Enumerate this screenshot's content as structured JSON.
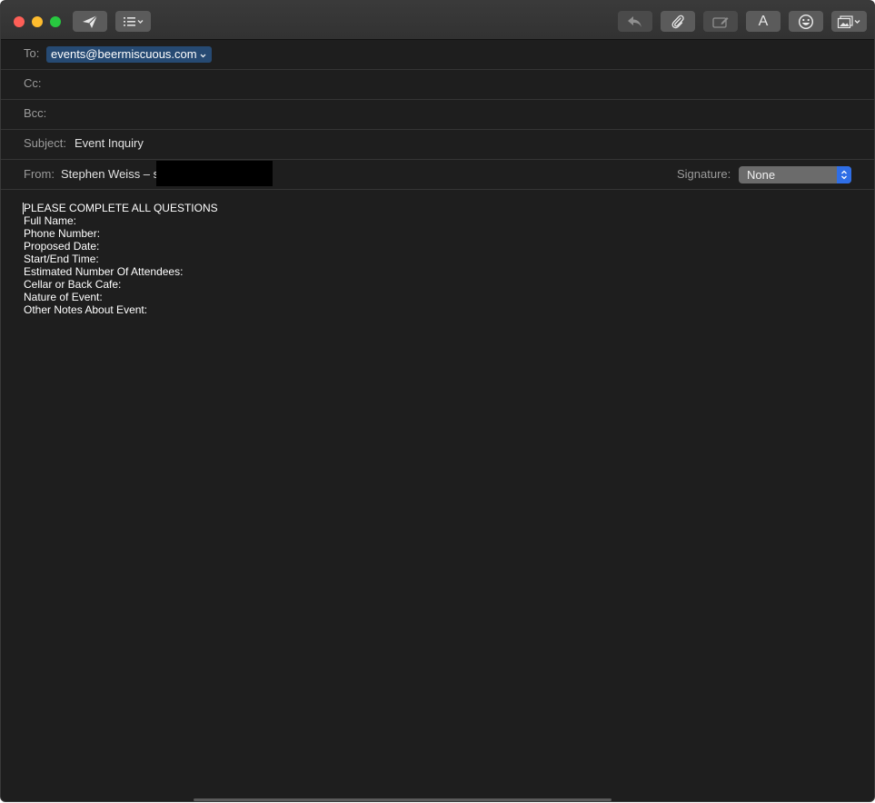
{
  "compose": {
    "to_label": "To:",
    "to_recipient": "events@beermiscuous.com",
    "cc_label": "Cc:",
    "bcc_label": "Bcc:",
    "subject_label": "Subject:",
    "subject_value": "Event Inquiry",
    "from_label": "From:",
    "from_value": "Stephen Weiss – s",
    "signature_label": "Signature:",
    "signature_value": "None"
  },
  "message_body": [
    "PLEASE COMPLETE ALL QUESTIONS",
    "Full Name:",
    "Phone Number:",
    "Proposed Date:",
    "Start/End Time:",
    "Estimated Number Of Attendees:",
    "Cellar or Back Cafe:",
    "Nature of Event:",
    "Other Notes About Event:"
  ],
  "toolbar": {
    "icons": [
      "send-icon",
      "header-fields-icon",
      "reply-icon",
      "attachment-icon",
      "markup-icon",
      "format-icon",
      "emoji-icon",
      "photo-browser-icon"
    ],
    "format_glyph": "A"
  }
}
